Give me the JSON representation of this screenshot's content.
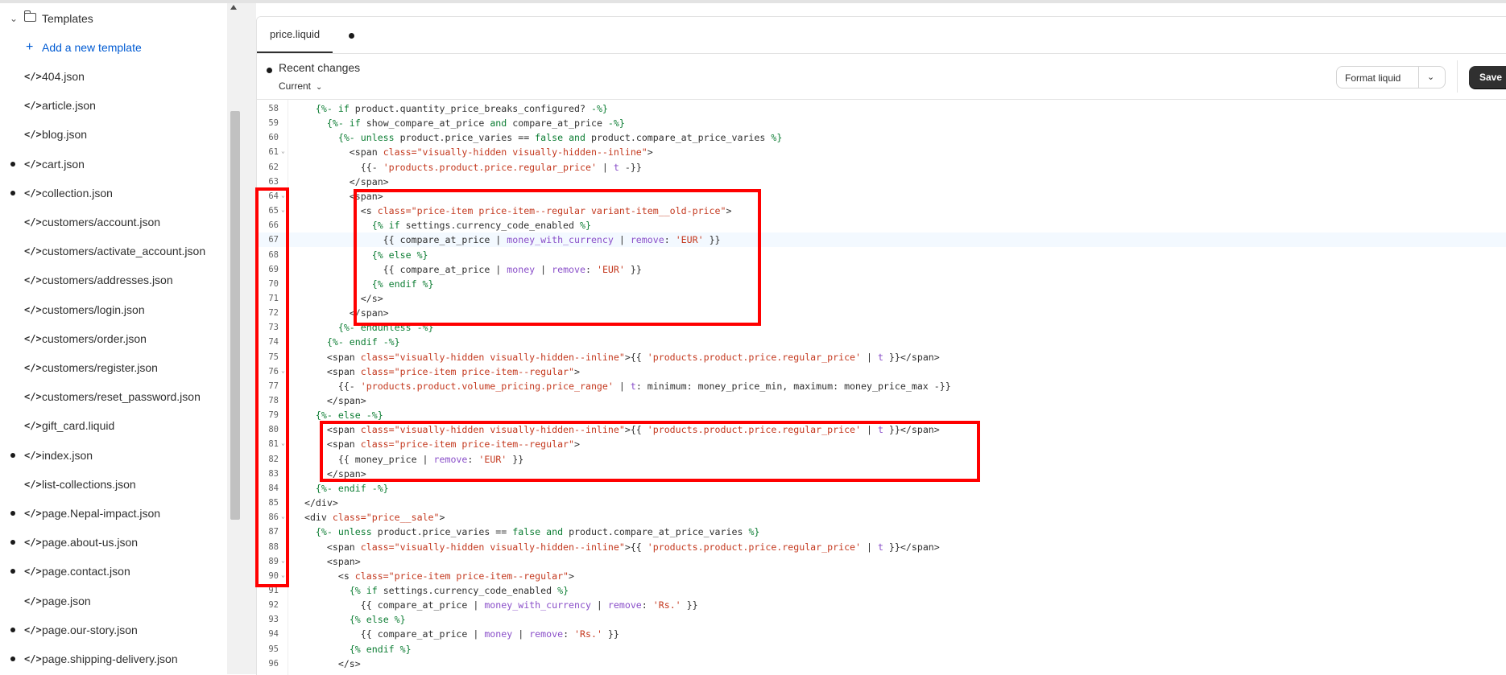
{
  "sidebar": {
    "folder_label": "Templates",
    "add_label": "Add a new template",
    "items": [
      {
        "name": "404.json",
        "dot": false
      },
      {
        "name": "article.json",
        "dot": false
      },
      {
        "name": "blog.json",
        "dot": false
      },
      {
        "name": "cart.json",
        "dot": true
      },
      {
        "name": "collection.json",
        "dot": true
      },
      {
        "name": "customers/account.json",
        "dot": false
      },
      {
        "name": "customers/activate_account.json",
        "dot": false
      },
      {
        "name": "customers/addresses.json",
        "dot": false
      },
      {
        "name": "customers/login.json",
        "dot": false
      },
      {
        "name": "customers/order.json",
        "dot": false
      },
      {
        "name": "customers/register.json",
        "dot": false
      },
      {
        "name": "customers/reset_password.json",
        "dot": false
      },
      {
        "name": "gift_card.liquid",
        "dot": false
      },
      {
        "name": "index.json",
        "dot": true
      },
      {
        "name": "list-collections.json",
        "dot": false
      },
      {
        "name": "page.Nepal-impact.json",
        "dot": true
      },
      {
        "name": "page.about-us.json",
        "dot": true
      },
      {
        "name": "page.contact.json",
        "dot": true
      },
      {
        "name": "page.json",
        "dot": false
      },
      {
        "name": "page.our-story.json",
        "dot": true
      },
      {
        "name": "page.shipping-delivery.json",
        "dot": true
      }
    ]
  },
  "tab": {
    "label": "price.liquid"
  },
  "toolbar": {
    "recent_changes": "Recent changes",
    "version_select": "Current",
    "format_label": "Format liquid",
    "save_label": "Save"
  },
  "code": {
    "active_line": 67,
    "lines": [
      {
        "n": 58,
        "fold": false,
        "html": "    <span class='k'>{%- if</span> product.quantity_price_breaks_configured? <span class='k'>-%}</span>"
      },
      {
        "n": 59,
        "fold": false,
        "html": "      <span class='k'>{%- if</span> show_compare_at_price <span class='k'>and</span> compare_at_price <span class='k'>-%}</span>"
      },
      {
        "n": 60,
        "fold": false,
        "html": "        <span class='k'>{%- unless</span> product.price_varies == <span class='k'>false</span> <span class='k'>and</span> product.compare_at_price_varies <span class='k'>%}</span>"
      },
      {
        "n": 61,
        "fold": true,
        "html": "          &lt;span <span class='a'>class=</span><span class='s'>\"visually-hidden visually-hidden--inline\"</span>&gt;"
      },
      {
        "n": 62,
        "fold": false,
        "html": "            {{- <span class='s'>'products.product.price.regular_price'</span> | <span class='f'>t</span> -}}"
      },
      {
        "n": 63,
        "fold": false,
        "html": "          &lt;/span&gt;"
      },
      {
        "n": 64,
        "fold": true,
        "html": "          &lt;span&gt;"
      },
      {
        "n": 65,
        "fold": true,
        "html": "            &lt;s <span class='a'>class=</span><span class='s'>\"price-item price-item--regular variant-item__old-price\"</span>&gt;"
      },
      {
        "n": 66,
        "fold": false,
        "html": "              <span class='k'>{% if</span> settings.currency_code_enabled <span class='k'>%}</span>"
      },
      {
        "n": 67,
        "fold": false,
        "html": "                {{ compare_at_price | <span class='f'>money_with_currency</span> | <span class='f'>remove</span>: <span class='s'>'EUR'</span> }}"
      },
      {
        "n": 68,
        "fold": false,
        "html": "              <span class='k'>{% else %}</span>"
      },
      {
        "n": 69,
        "fold": false,
        "html": "                {{ compare_at_price | <span class='f'>money</span> | <span class='f'>remove</span>: <span class='s'>'EUR'</span> }}"
      },
      {
        "n": 70,
        "fold": false,
        "html": "              <span class='k'>{% endif %}</span>"
      },
      {
        "n": 71,
        "fold": false,
        "html": "            &lt;/s&gt;"
      },
      {
        "n": 72,
        "fold": false,
        "html": "          &lt;/span&gt;"
      },
      {
        "n": 73,
        "fold": false,
        "html": "        <span class='k'>{%- endunless -%}</span>"
      },
      {
        "n": 74,
        "fold": false,
        "html": "      <span class='k'>{%- endif -%}</span>"
      },
      {
        "n": 75,
        "fold": false,
        "html": "      &lt;span <span class='a'>class=</span><span class='s'>\"visually-hidden visually-hidden--inline\"</span>&gt;{{ <span class='s'>'products.product.price.regular_price'</span> | <span class='f'>t</span> }}&lt;/span&gt;"
      },
      {
        "n": 76,
        "fold": true,
        "html": "      &lt;span <span class='a'>class=</span><span class='s'>\"price-item price-item--regular\"</span>&gt;"
      },
      {
        "n": 77,
        "fold": false,
        "html": "        {{- <span class='s'>'products.product.volume_pricing.price_range'</span> | <span class='f'>t</span>: minimum: money_price_min, maximum: money_price_max -}}"
      },
      {
        "n": 78,
        "fold": false,
        "html": "      &lt;/span&gt;"
      },
      {
        "n": 79,
        "fold": false,
        "html": "    <span class='k'>{%- else -%}</span>"
      },
      {
        "n": 80,
        "fold": false,
        "html": "      &lt;span <span class='a'>class=</span><span class='s'>\"visually-hidden visually-hidden--inline\"</span>&gt;{{ <span class='s'>'products.product.price.regular_price'</span> | <span class='f'>t</span> }}&lt;/span&gt;"
      },
      {
        "n": 81,
        "fold": true,
        "html": "      &lt;span <span class='a'>class=</span><span class='s'>\"price-item price-item--regular\"</span>&gt;"
      },
      {
        "n": 82,
        "fold": false,
        "html": "        {{ money_price | <span class='f'>remove</span>: <span class='s'>'EUR'</span> }}"
      },
      {
        "n": 83,
        "fold": false,
        "html": "      &lt;/span&gt;"
      },
      {
        "n": 84,
        "fold": false,
        "html": "    <span class='k'>{%- endif -%}</span>"
      },
      {
        "n": 85,
        "fold": false,
        "html": "  &lt;/div&gt;"
      },
      {
        "n": 86,
        "fold": true,
        "html": "  &lt;div <span class='a'>class=</span><span class='s'>\"price__sale\"</span>&gt;"
      },
      {
        "n": 87,
        "fold": false,
        "html": "    <span class='k'>{%- unless</span> product.price_varies == <span class='k'>false</span> <span class='k'>and</span> product.compare_at_price_varies <span class='k'>%}</span>"
      },
      {
        "n": 88,
        "fold": false,
        "html": "      &lt;span <span class='a'>class=</span><span class='s'>\"visually-hidden visually-hidden--inline\"</span>&gt;{{ <span class='s'>'products.product.price.regular_price'</span> | <span class='f'>t</span> }}&lt;/span&gt;"
      },
      {
        "n": 89,
        "fold": true,
        "html": "      &lt;span&gt;"
      },
      {
        "n": 90,
        "fold": true,
        "html": "        &lt;s <span class='a'>class=</span><span class='s'>\"price-item price-item--regular\"</span>&gt;"
      },
      {
        "n": 91,
        "fold": false,
        "html": "          <span class='k'>{% if</span> settings.currency_code_enabled <span class='k'>%}</span>"
      },
      {
        "n": 92,
        "fold": false,
        "html": "            {{ compare_at_price | <span class='f'>money_with_currency</span> | <span class='f'>remove</span>: <span class='s'>'Rs.'</span> }}"
      },
      {
        "n": 93,
        "fold": false,
        "html": "          <span class='k'>{% else %}</span>"
      },
      {
        "n": 94,
        "fold": false,
        "html": "            {{ compare_at_price | <span class='f'>money</span> | <span class='f'>remove</span>: <span class='s'>'Rs.'</span> }}"
      },
      {
        "n": 95,
        "fold": false,
        "html": "          <span class='k'>{% endif %}</span>"
      },
      {
        "n": 96,
        "fold": false,
        "html": "        &lt;/s&gt;"
      }
    ]
  },
  "annotation_color": "#ff0000"
}
